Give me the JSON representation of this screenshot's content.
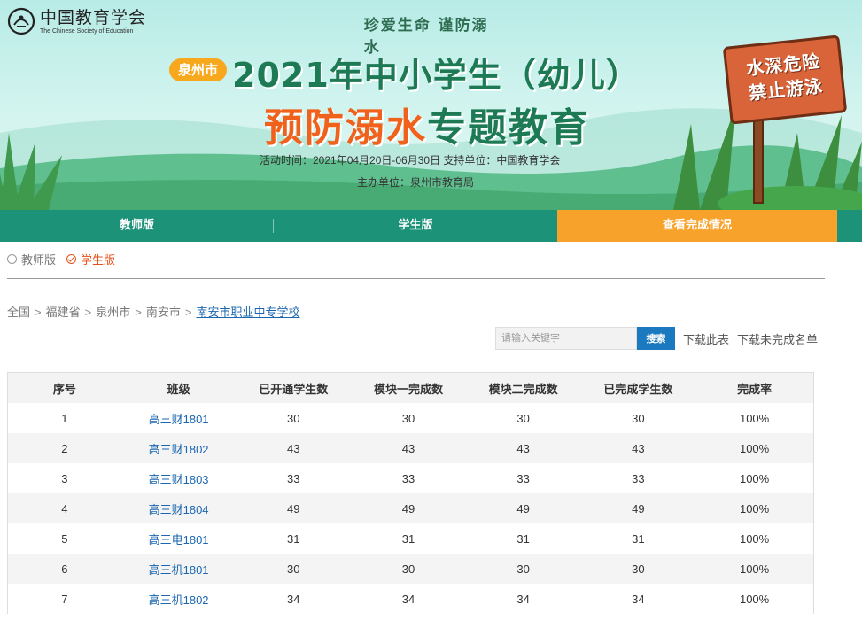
{
  "header": {
    "logo_cn": "中国教育学会",
    "logo_en": "The Chinese Society of Education",
    "slogan": "珍爱生命  谨防溺水",
    "city": "泉州市",
    "title_line1": "2021年中小学生（幼儿）",
    "title_line2_orange": "预防溺水",
    "title_line2_green": "专题教育",
    "info_time": "活动时间：2021年04月20日-06月30日   支持单位：中国教育学会",
    "info_host": "主办单位：泉州市教育局",
    "sign_line1": "水深危险",
    "sign_line2": "禁止游泳"
  },
  "nav": {
    "items": [
      "教师版",
      "学生版",
      "查看完成情况"
    ],
    "active": "查看完成情况"
  },
  "version": {
    "teacher": "教师版",
    "student": "学生版",
    "selected": "学生版"
  },
  "breadcrumb": [
    "全国",
    "福建省",
    "泉州市",
    "南安市",
    "南安市职业中专学校"
  ],
  "search": {
    "placeholder": "请输入关键字",
    "button": "搜索",
    "download_list": "下载此表",
    "download_incomplete": "下载未完成名单"
  },
  "table": {
    "headers": [
      "序号",
      "班级",
      "已开通学生数",
      "模块一完成数",
      "模块二完成数",
      "已完成学生数",
      "完成率"
    ],
    "rows": [
      [
        "1",
        "高三财1801",
        "30",
        "30",
        "30",
        "30",
        "100%"
      ],
      [
        "2",
        "高三财1802",
        "43",
        "43",
        "43",
        "43",
        "100%"
      ],
      [
        "3",
        "高三财1803",
        "33",
        "33",
        "33",
        "33",
        "100%"
      ],
      [
        "4",
        "高三财1804",
        "49",
        "49",
        "49",
        "49",
        "100%"
      ],
      [
        "5",
        "高三电1801",
        "31",
        "31",
        "31",
        "31",
        "100%"
      ],
      [
        "6",
        "高三机1801",
        "30",
        "30",
        "30",
        "30",
        "100%"
      ],
      [
        "7",
        "高三机1802",
        "34",
        "34",
        "34",
        "34",
        "100%"
      ]
    ]
  },
  "colors": {
    "nav_green": "#1c9278",
    "nav_active_orange": "#f7a22a",
    "title_green": "#1d7a55",
    "title_orange": "#f0621c",
    "link_blue": "#1b66b0",
    "search_blue": "#1b79c0"
  }
}
